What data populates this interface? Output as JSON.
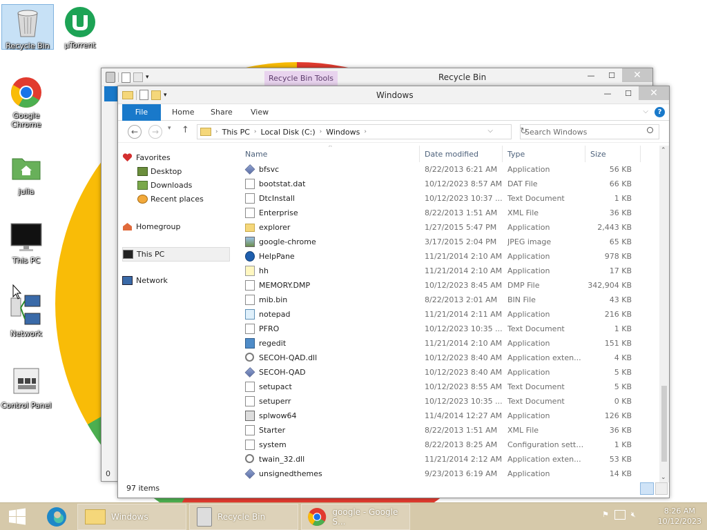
{
  "desktop": {
    "icons": [
      {
        "label": "Recycle Bin",
        "icon": "recycle-bin-icon"
      },
      {
        "label": "µTorrent",
        "icon": "utorrent-icon"
      },
      {
        "label": "Google Chrome",
        "icon": "chrome-icon"
      },
      {
        "label": "julia",
        "icon": "user-folder-icon"
      },
      {
        "label": "This PC",
        "icon": "monitor-icon"
      },
      {
        "label": "Network",
        "icon": "network-icon"
      },
      {
        "label": "Control Panel",
        "icon": "control-panel-icon"
      }
    ]
  },
  "back_window": {
    "title": "Recycle Bin",
    "contextual_tab": "Recycle Bin Tools",
    "status_fragment": "0"
  },
  "window": {
    "title": "Windows",
    "ribbon_tabs": [
      "File",
      "Home",
      "Share",
      "View"
    ],
    "address": {
      "crumbs": [
        "This PC",
        "Local Disk (C:)",
        "Windows"
      ],
      "search_placeholder": "Search Windows"
    },
    "nav": {
      "favorites": "Favorites",
      "desktop": "Desktop",
      "downloads": "Downloads",
      "recent": "Recent places",
      "homegroup": "Homegroup",
      "thispc": "This PC",
      "network": "Network"
    },
    "columns": {
      "name": "Name",
      "date": "Date modified",
      "type": "Type",
      "size": "Size"
    },
    "files": [
      {
        "name": "bfsvc",
        "date": "8/22/2013 6:21 AM",
        "type": "Application",
        "size": "56 KB",
        "icon": "app"
      },
      {
        "name": "bootstat.dat",
        "date": "10/12/2023 8:57 AM",
        "type": "DAT File",
        "size": "66 KB",
        "icon": "doc"
      },
      {
        "name": "DtcInstall",
        "date": "10/12/2023 10:37 ...",
        "type": "Text Document",
        "size": "1 KB",
        "icon": "doc"
      },
      {
        "name": "Enterprise",
        "date": "8/22/2013 1:51 AM",
        "type": "XML File",
        "size": "36 KB",
        "icon": "doc"
      },
      {
        "name": "explorer",
        "date": "1/27/2015 5:47 PM",
        "type": "Application",
        "size": "2,443 KB",
        "icon": "folder"
      },
      {
        "name": "google-chrome",
        "date": "3/17/2015 2:04 PM",
        "type": "JPEG image",
        "size": "65 KB",
        "icon": "image"
      },
      {
        "name": "HelpPane",
        "date": "11/21/2014 2:10 AM",
        "type": "Application",
        "size": "978 KB",
        "icon": "help"
      },
      {
        "name": "hh",
        "date": "11/21/2014 2:10 AM",
        "type": "Application",
        "size": "17 KB",
        "icon": "help-doc"
      },
      {
        "name": "MEMORY.DMP",
        "date": "10/12/2023 8:45 AM",
        "type": "DMP File",
        "size": "342,904 KB",
        "icon": "doc"
      },
      {
        "name": "mib.bin",
        "date": "8/22/2013 2:01 AM",
        "type": "BIN File",
        "size": "43 KB",
        "icon": "doc"
      },
      {
        "name": "notepad",
        "date": "11/21/2014 2:11 AM",
        "type": "Application",
        "size": "216 KB",
        "icon": "notepad"
      },
      {
        "name": "PFRO",
        "date": "10/12/2023 10:35 ...",
        "type": "Text Document",
        "size": "1 KB",
        "icon": "doc"
      },
      {
        "name": "regedit",
        "date": "11/21/2014 2:10 AM",
        "type": "Application",
        "size": "151 KB",
        "icon": "regedit"
      },
      {
        "name": "SECOH-QAD.dll",
        "date": "10/12/2023 8:40 AM",
        "type": "Application exten...",
        "size": "4 KB",
        "icon": "gear"
      },
      {
        "name": "SECOH-QAD",
        "date": "10/12/2023 8:40 AM",
        "type": "Application",
        "size": "5 KB",
        "icon": "app"
      },
      {
        "name": "setupact",
        "date": "10/12/2023 8:55 AM",
        "type": "Text Document",
        "size": "5 KB",
        "icon": "doc"
      },
      {
        "name": "setuperr",
        "date": "10/12/2023 10:35 ...",
        "type": "Text Document",
        "size": "0 KB",
        "icon": "doc"
      },
      {
        "name": "splwow64",
        "date": "11/4/2014 12:27 AM",
        "type": "Application",
        "size": "126 KB",
        "icon": "printer"
      },
      {
        "name": "Starter",
        "date": "8/22/2013 1:51 AM",
        "type": "XML File",
        "size": "36 KB",
        "icon": "doc"
      },
      {
        "name": "system",
        "date": "8/22/2013 8:25 AM",
        "type": "Configuration setti...",
        "size": "1 KB",
        "icon": "doc"
      },
      {
        "name": "twain_32.dll",
        "date": "11/21/2014 2:12 AM",
        "type": "Application exten...",
        "size": "53 KB",
        "icon": "gear"
      },
      {
        "name": "unsignedthemes",
        "date": "9/23/2013 6:19 AM",
        "type": "Application",
        "size": "14 KB",
        "icon": "app"
      }
    ],
    "status": "97 items"
  },
  "taskbar": {
    "items": [
      {
        "label": "Windows",
        "icon": "folder-icon"
      },
      {
        "label": "Recycle Bin",
        "icon": "recycle-bin-icon"
      },
      {
        "label": "google - Google S...",
        "icon": "chrome-icon"
      }
    ],
    "time": "8:26 AM",
    "date": "10/12/2023"
  },
  "colors": {
    "accent": "#1979ca",
    "taskbar": "#d6c9aa",
    "chrome_red": "#e13b2f",
    "chrome_yellow": "#f9bc07",
    "chrome_green": "#4caf50"
  }
}
